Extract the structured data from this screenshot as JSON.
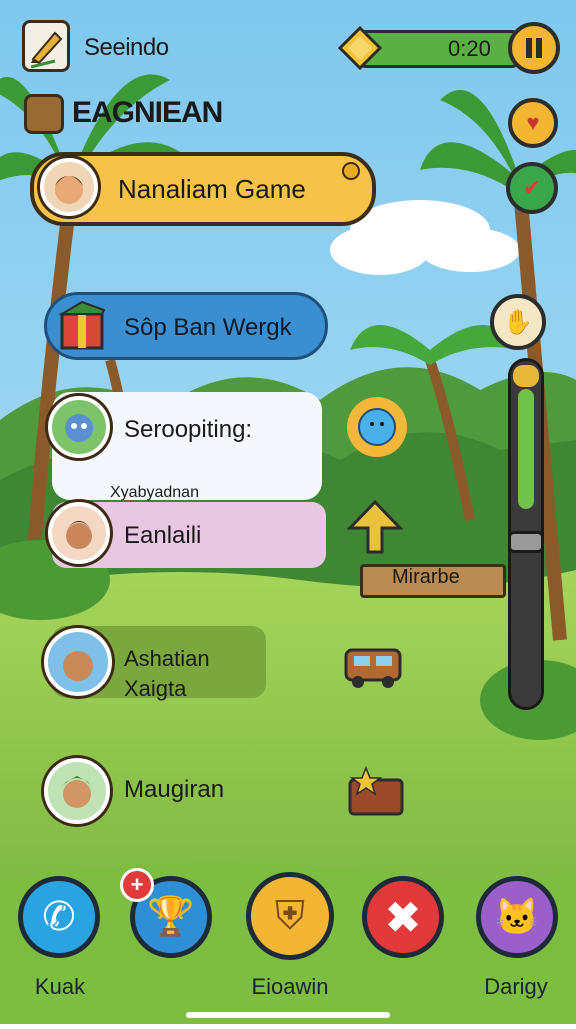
{
  "header": {
    "title_small": "Seeindo",
    "title_big": "EAGNIEAN",
    "score": "0:20"
  },
  "profile": {
    "name": "Nanaliam Game"
  },
  "menu": [
    {
      "label": "Sôp Ban Wergk"
    },
    {
      "label": "Seroopiting:",
      "caption": "Xyabyadnan"
    },
    {
      "label": "Eanlaili"
    },
    {
      "label": "Ashatian\nXaigta"
    },
    {
      "label": "Maugiran"
    }
  ],
  "signpost": {
    "label": "Mirarbe"
  },
  "side_slider": {
    "level": 0.35
  },
  "bottom_nav": [
    {
      "label": "Kuak",
      "icon": "phone-icon",
      "color": "#2aa4e0"
    },
    {
      "label": "",
      "icon": "trophy-icon",
      "color": "#2f8fd6",
      "badge": "+"
    },
    {
      "label": "Eioawin",
      "icon": "shield-icon",
      "color": "#f2b632"
    },
    {
      "label": "",
      "icon": "close-icon",
      "color": "#e23a3a"
    },
    {
      "label": "Darigy",
      "icon": "cat-icon",
      "color": "#9b5fc9"
    }
  ],
  "colors": {
    "sky": "#8fd0ef",
    "grass": "#8bc34a",
    "gold": "#f5c242",
    "blue_panel": "#3b8fd0",
    "pink_panel": "#e8c7e3",
    "green_panel": "#7aa83e"
  }
}
